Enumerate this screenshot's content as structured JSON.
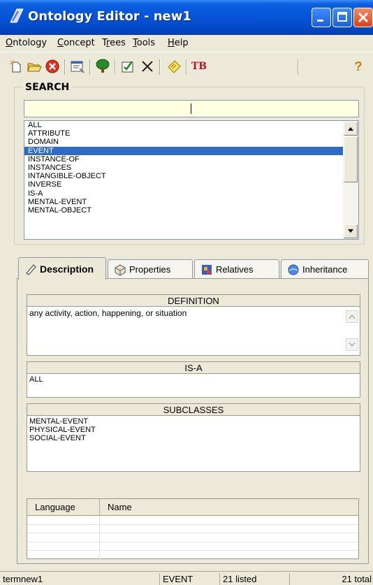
{
  "window": {
    "title": "Ontology Editor - new1"
  },
  "menu": [
    {
      "label": "Ontology",
      "key": "O"
    },
    {
      "label": "Concept",
      "key": "C"
    },
    {
      "label": "Trees",
      "key": "r"
    },
    {
      "label": "Tools",
      "key": "T"
    },
    {
      "label": "Help",
      "key": "H"
    }
  ],
  "toolbar": {
    "icons": [
      "new-icon",
      "open-icon",
      "delete-icon",
      "properties-icon",
      "tree-icon",
      "edit-icon",
      "cut-icon",
      "note-icon",
      "tb-icon",
      "help-icon"
    ],
    "tb_label": "TB",
    "help_label": "?"
  },
  "search": {
    "title": "SEARCH",
    "value": "",
    "list": [
      "ALL",
      "ATTRIBUTE",
      "DOMAIN",
      "EVENT",
      "INSTANCE-OF",
      "INSTANCES",
      "INTANGIBLE-OBJECT",
      "INVERSE",
      "IS-A",
      "MENTAL-EVENT",
      "MENTAL-OBJECT"
    ],
    "selected_index": 3
  },
  "tabs": [
    {
      "label": "Description",
      "active": true
    },
    {
      "label": "Properties",
      "active": false
    },
    {
      "label": "Relatives",
      "active": false
    },
    {
      "label": "Inheritance",
      "active": false
    }
  ],
  "description": {
    "definition_header": "DEFINITION",
    "definition_text": "any activity, action, happening, or situation",
    "isa_header": "IS-A",
    "isa_values": [
      "ALL"
    ],
    "subclasses_header": "SUBCLASSES",
    "subclasses": [
      "MENTAL-EVENT",
      "PHYSICAL-EVENT",
      "SOCIAL-EVENT"
    ],
    "grid_headers": [
      "Language",
      "Name"
    ]
  },
  "status": {
    "term": "termnew1",
    "concept": "EVENT",
    "listed": "21 listed",
    "total": "21 total"
  },
  "colors": {
    "titlebar": "#0553d8",
    "selection": "#316AC5",
    "search_bg": "#FFFFE1",
    "window_bg": "#ECE9D8"
  }
}
